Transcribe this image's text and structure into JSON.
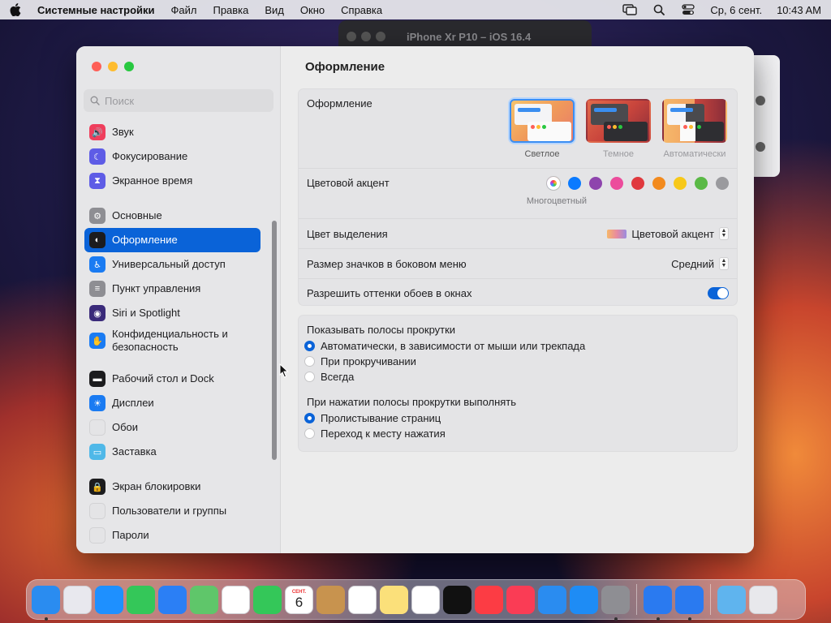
{
  "menubar": {
    "app_name": "Системные настройки",
    "menus": [
      "Файл",
      "Правка",
      "Вид",
      "Окно",
      "Справка"
    ],
    "date": "Ср, 6 сент.",
    "time": "10:43 AM"
  },
  "background_window": {
    "title": "iPhone Xr P10 – iOS 16.4"
  },
  "sidebar": {
    "search_placeholder": "Поиск",
    "groups": [
      [
        {
          "label": "Звук",
          "icon": "speaker-icon",
          "color": "#ef3e5c"
        },
        {
          "label": "Фокусирование",
          "icon": "moon-icon",
          "color": "#5e5ce6"
        },
        {
          "label": "Экранное время",
          "icon": "hourglass-icon",
          "color": "#5e5ce6"
        }
      ],
      [
        {
          "label": "Основные",
          "icon": "gear-icon",
          "color": "#8e8e93"
        },
        {
          "label": "Оформление",
          "icon": "appearance-icon",
          "color": "#1c1c1e",
          "selected": true
        },
        {
          "label": "Универсальный доступ",
          "icon": "accessibility-icon",
          "color": "#1a7bf2"
        },
        {
          "label": "Пункт управления",
          "icon": "control-center-icon",
          "color": "#8e8e93"
        },
        {
          "label": "Siri и Spotlight",
          "icon": "siri-icon",
          "color": "#3a2a7a"
        },
        {
          "label": "Конфиденциальность и безопасность",
          "icon": "hand-icon",
          "color": "#1a7bf2"
        }
      ],
      [
        {
          "label": "Рабочий стол и Dock",
          "icon": "dock-icon",
          "color": "#1c1c1e"
        },
        {
          "label": "Дисплеи",
          "icon": "sun-icon",
          "color": "#1a7bf2"
        },
        {
          "label": "Обои",
          "icon": "wallpaper-icon",
          "color": "#e4e4e6"
        },
        {
          "label": "Заставка",
          "icon": "screensaver-icon",
          "color": "#4fb8e8"
        }
      ],
      [
        {
          "label": "Экран блокировки",
          "icon": "lock-icon",
          "color": "#1c1c1e"
        },
        {
          "label": "Пользователи и группы",
          "icon": "users-icon",
          "color": "#e4e4e6"
        },
        {
          "label": "Пароли",
          "icon": "key-icon",
          "color": "#e4e4e6"
        }
      ]
    ]
  },
  "content": {
    "title": "Оформление",
    "appearance": {
      "label": "Оформление",
      "options": [
        {
          "label": "Светлое",
          "selected": true
        },
        {
          "label": "Темное",
          "selected": false
        },
        {
          "label": "Автоматически",
          "selected": false
        }
      ]
    },
    "accent": {
      "label": "Цветовой акцент",
      "selected_label": "Многоцветный",
      "colors": [
        "multicolor",
        "#0a7aff",
        "#8e44ad",
        "#ec4c9c",
        "#e0393e",
        "#f28a1e",
        "#f7c819",
        "#5ab946",
        "#9a9a9e"
      ]
    },
    "highlight": {
      "label": "Цвет выделения",
      "value": "Цветовой акцент"
    },
    "sidebar_icon_size": {
      "label": "Размер значков в боковом меню",
      "value": "Средний"
    },
    "wallpaper_tint": {
      "label": "Разрешить оттенки обоев в окнах",
      "on": true
    },
    "scrollbars": {
      "label": "Показывать полосы прокрутки",
      "options": [
        {
          "label": "Автоматически, в зависимости от мыши или трекпада",
          "selected": true
        },
        {
          "label": "При прокручивании",
          "selected": false
        },
        {
          "label": "Всегда",
          "selected": false
        }
      ]
    },
    "click_scrollbar": {
      "label": "При нажатии полосы прокрутки выполнять",
      "options": [
        {
          "label": "Пролистывание страниц",
          "selected": true
        },
        {
          "label": "Переход к месту нажатия",
          "selected": false
        }
      ]
    },
    "help_label": "?"
  },
  "dock": {
    "calendar_month": "СЕНТ.",
    "calendar_day": "6",
    "apps": [
      {
        "name": "finder-icon",
        "color": "#2a8cf0",
        "running": true
      },
      {
        "name": "launchpad-icon",
        "color": "#e8e8ee",
        "running": false
      },
      {
        "name": "safari-icon",
        "color": "#1e90ff",
        "running": false
      },
      {
        "name": "messages-icon",
        "color": "#34c759",
        "running": false
      },
      {
        "name": "mail-icon",
        "color": "#2b7ff5",
        "running": false
      },
      {
        "name": "maps-icon",
        "color": "#5fc66a",
        "running": false
      },
      {
        "name": "photos-icon",
        "color": "#ffffff",
        "running": false
      },
      {
        "name": "facetime-icon",
        "color": "#34c759",
        "running": false
      },
      {
        "name": "calendar-icon",
        "color": "#ffffff",
        "running": false
      },
      {
        "name": "contacts-icon",
        "color": "#c8934e",
        "running": false
      },
      {
        "name": "reminders-icon",
        "color": "#ffffff",
        "running": false
      },
      {
        "name": "notes-icon",
        "color": "#fbe07a",
        "running": false
      },
      {
        "name": "freeform-icon",
        "color": "#ffffff",
        "running": false
      },
      {
        "name": "tv-icon",
        "color": "#111111",
        "running": false
      },
      {
        "name": "music-icon",
        "color": "#fc3c44",
        "running": false
      },
      {
        "name": "news-icon",
        "color": "#fa3c55",
        "running": false
      },
      {
        "name": "keynote-icon",
        "color": "#2a8cf0",
        "running": false
      },
      {
        "name": "app-store-icon",
        "color": "#1e8cf5",
        "running": false
      },
      {
        "name": "system-settings-icon",
        "color": "#8e8e93",
        "running": true
      }
    ],
    "apps2": [
      {
        "name": "xcode-icon",
        "color": "#2a7af0",
        "running": true
      },
      {
        "name": "simulator-icon",
        "color": "#2a7af0",
        "running": true
      }
    ],
    "apps3": [
      {
        "name": "downloads-folder-icon",
        "color": "#5fb4ee",
        "running": false
      },
      {
        "name": "trash-icon",
        "color": "#e8e8ec",
        "running": false
      }
    ]
  }
}
